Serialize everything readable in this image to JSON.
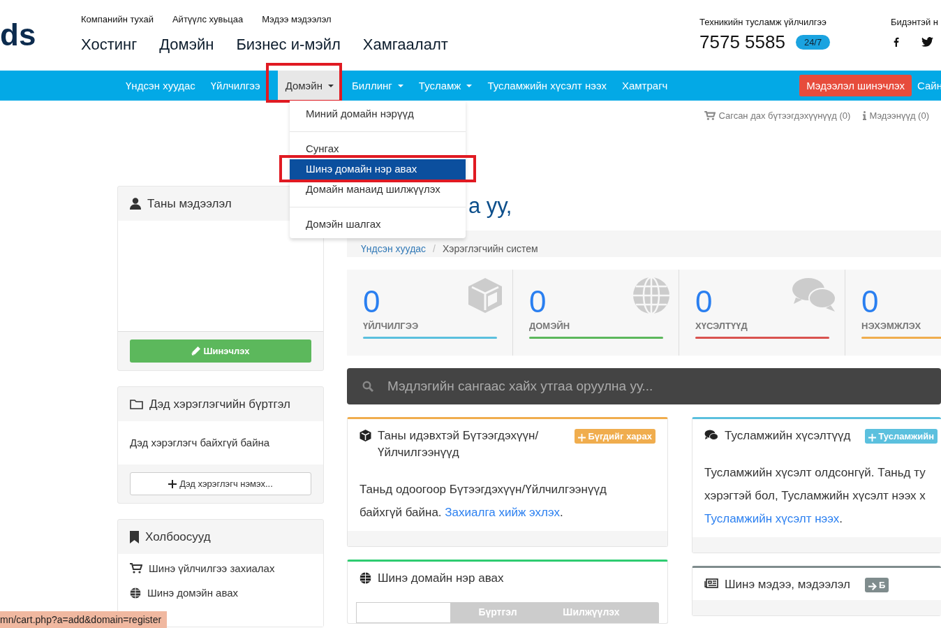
{
  "logo": "ds",
  "top_links": [
    "Компанийн тухай",
    "Айтүүлс хувьцаа",
    "Мэдээ мэдээлэл"
  ],
  "main_menu": [
    "Хостинг",
    "Домэйн",
    "Бизнес и-мэйл",
    "Хамгаалалт"
  ],
  "support": {
    "label": "Техникийн тусламж үйлчилгээ",
    "phone": "7575 5585",
    "badge": "24/7"
  },
  "social": {
    "label": "Бидэнтэй н"
  },
  "nav": {
    "items": [
      {
        "label": "Үндсэн хуудас",
        "dropdown": false,
        "selected": false,
        "annotated": false
      },
      {
        "label": "Үйлчилгээ",
        "dropdown": false,
        "selected": false,
        "annotated": false
      },
      {
        "label": "Домэйн",
        "dropdown": true,
        "selected": true,
        "annotated": true
      },
      {
        "label": "Биллинг",
        "dropdown": true,
        "selected": false,
        "annotated": false
      },
      {
        "label": "Тусламж",
        "dropdown": true,
        "selected": false,
        "annotated": false
      },
      {
        "label": "Тусламжийн хүсэлт нээх",
        "dropdown": false,
        "selected": false,
        "annotated": false
      },
      {
        "label": "Хамтрагч",
        "dropdown": false,
        "selected": false,
        "annotated": false
      }
    ],
    "update_button": "Мэдээлэл шинэчлэх",
    "greeting": "Сайн"
  },
  "dropdown": [
    {
      "label": "Миний домайн нэрүүд",
      "selected": false,
      "annotated": false,
      "divider_after": true
    },
    {
      "label": "Сунгах",
      "selected": false,
      "annotated": false,
      "divider_after": false
    },
    {
      "label": "Шинэ домайн нэр авах",
      "selected": true,
      "annotated": true,
      "divider_after": false
    },
    {
      "label": "Домайн манаид шилжүүлэх",
      "selected": false,
      "annotated": false,
      "divider_after": true
    },
    {
      "label": "Домэйн шалгах",
      "selected": false,
      "annotated": false,
      "divider_after": false
    }
  ],
  "cart_links": [
    {
      "kind": "cart",
      "label": "Сагсан дах бүтээгдэхүүнүүд (0)"
    },
    {
      "kind": "info",
      "label": "Мэдээнүүд (0)"
    }
  ],
  "sidebar": [
    {
      "kind": "profile",
      "title": "Таны мэдээлэл",
      "button": "Шинэчлэх"
    },
    {
      "kind": "contacts",
      "title": "Дэд хэрэглэгчийн бүртгэл",
      "text": "Дэд хэрэглэгч байхгүй байна",
      "button": "Дэд хэрэглэгч нэмэх..."
    },
    {
      "kind": "links",
      "title": "Холбоосууд",
      "items": [
        {
          "kind": "cart",
          "label": "Шинэ үйлчилгээ захиалах"
        },
        {
          "kind": "globe",
          "label": "Шинэ домэйн авах"
        }
      ]
    }
  ],
  "heading": "а уу,",
  "breadcrumb": [
    "Үндсэн хуудас",
    "Хэрэглэгчийн систем"
  ],
  "breadcrumb_separator": "/",
  "stats": [
    {
      "kind": "box",
      "value": "0",
      "label": "ҮЙЛЧИЛГЭЭ",
      "color": "#5bc0de"
    },
    {
      "kind": "globe",
      "value": "0",
      "label": "ДОМЭЙН",
      "color": "#5cb85c"
    },
    {
      "kind": "chat",
      "value": "0",
      "label": "ХҮСЭЛТҮҮД",
      "color": "#d9534f"
    },
    {
      "kind": "none",
      "value": "0",
      "label": "НЭХЭМЖЛЭХ",
      "color": "#f0ad4e"
    }
  ],
  "search": {
    "placeholder": "Мэдлэгийн сангаас хайх утгаа оруулна уу..."
  },
  "panels": [
    [
      {
        "kind": "products",
        "title": "Таны идэвхтэй Бүтээгдэхүүн/ Үйлчилгээнүүд",
        "color": "#f0ad4e",
        "button": {
          "kind": "plus",
          "label": "Бүгдийг харах"
        },
        "text": "Таньд одоогоор Бүтээгдэхүүн/Үйлчилгээнүүд байхгүй байна.",
        "link": "Захиалга хийж эхлэх",
        "end": "."
      },
      {
        "kind": "domain",
        "title": "Шинэ домайн нэр авах",
        "color": "#2ecc71",
        "tabs": [
          {
            "selected": true
          },
          {
            "label": "Бүртгэл",
            "selected": false
          },
          {
            "label": "Шилжүүлэх",
            "selected": false
          }
        ]
      }
    ],
    [
      {
        "kind": "tickets",
        "title": "Тусламжийн хүсэлтүүд",
        "color": "#5bc0de",
        "button": {
          "kind": "plus",
          "label": "Тусламжийн"
        },
        "lines": [
          "Тусламжийн хүсэлт олдсонгүй. Таньд ту",
          "хэрэгтэй бол, Тусламжийн хүсэлт нээх х"
        ],
        "link": "Тусламжийн хүсэлт нээх",
        "end": "."
      },
      {
        "kind": "news",
        "title": "Шинэ мэдээ, мэдээлэл",
        "color": "#7f8c8d",
        "button": {
          "kind": "arrow",
          "label": "Б"
        }
      }
    ]
  ],
  "status_url": "mn/cart.php?a=add&domain=register"
}
